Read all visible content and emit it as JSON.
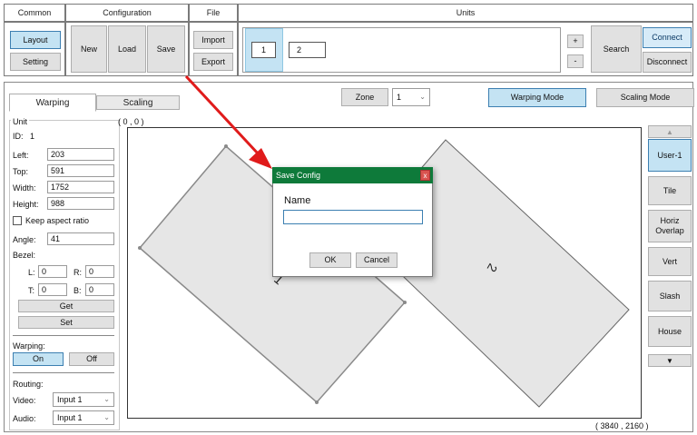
{
  "ribbon": {
    "groups": {
      "common": "Common",
      "configuration": "Configuration",
      "file": "File",
      "units": "Units"
    },
    "layout": "Layout",
    "setting": "Setting",
    "new": "New",
    "load": "Load",
    "save": "Save",
    "import": "Import",
    "export": "Export",
    "unit_1": "1",
    "unit_2": "2",
    "plus": "+",
    "minus": "-",
    "search": "Search",
    "connect": "Connect",
    "disconnect": "Disconnect"
  },
  "tabs": {
    "warping": "Warping",
    "scaling": "Scaling"
  },
  "zone": {
    "label": "Zone",
    "value": "1"
  },
  "modes": {
    "warping": "Warping Mode",
    "scaling": "Scaling Mode"
  },
  "unit_panel": {
    "title": "Unit",
    "id_label": "ID:",
    "id_value": "1",
    "left_label": "Left:",
    "left_value": "203",
    "top_label": "Top:",
    "top_value": "591",
    "width_label": "Width:",
    "width_value": "1752",
    "height_label": "Height:",
    "height_value": "988",
    "keep_aspect": "Keep aspect ratio",
    "angle_label": "Angle:",
    "angle_value": "41",
    "bezel_label": "Bezel:",
    "l_label": "L:",
    "l_value": "0",
    "r_label": "R:",
    "r_value": "0",
    "t_label": "T:",
    "t_value": "0",
    "b_label": "B:",
    "b_value": "0",
    "get": "Get",
    "set": "Set",
    "warping_label": "Warping:",
    "on": "On",
    "off": "Off",
    "routing_label": "Routing:",
    "video_label": "Video:",
    "video_value": "Input 1",
    "audio_label": "Audio:",
    "audio_value": "Input 1"
  },
  "canvas": {
    "origin": "( 0 , 0 )",
    "extent": "( 3840 , 2160 )",
    "unit_labels": [
      "1",
      "2"
    ]
  },
  "layouts": {
    "items": [
      "User-1",
      "Tile",
      "Horiz\nOverlap",
      "Vert",
      "Slash",
      "House"
    ],
    "up": "▲",
    "down": "▼"
  },
  "dialog": {
    "title": "Save Config",
    "close": "x",
    "name_label": "Name",
    "name_value": "",
    "ok": "OK",
    "cancel": "Cancel"
  },
  "colors": {
    "dialog_title_bg": "#0e7a3a",
    "close_bg": "#d9534f",
    "arrow": "#e01b1b",
    "selected_bg": "#c4e3f3"
  }
}
